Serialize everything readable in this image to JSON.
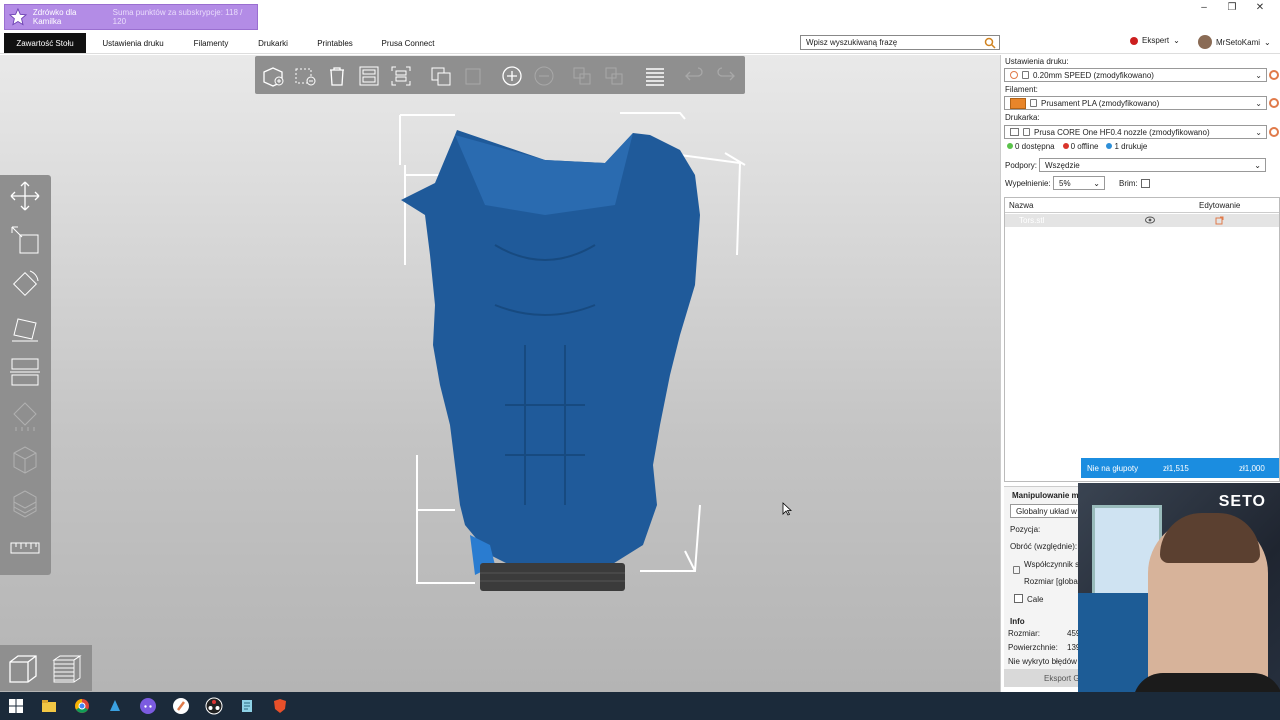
{
  "overlay": {
    "title": "Zdrówko dla Kamilka",
    "subtitle": "Suma punktów za subskrypcje: 118 / 120"
  },
  "window_controls": {
    "minimize": "–",
    "restore": "❐",
    "close": "✕"
  },
  "tabs": [
    {
      "label": "Zawartość Stołu",
      "active": true
    },
    {
      "label": "Ustawienia druku"
    },
    {
      "label": "Filamenty"
    },
    {
      "label": "Drukarki"
    },
    {
      "label": "Printables"
    },
    {
      "label": "Prusa Connect"
    }
  ],
  "search": {
    "placeholder": "Wpisz wyszukiwaną frazę"
  },
  "mode": {
    "label": "Ekspert"
  },
  "user": {
    "name": "MrSetoKami"
  },
  "right_panel": {
    "print_settings_label": "Ustawienia druku:",
    "print_settings_value": "0.20mm SPEED (zmodyfikowano)",
    "filament_label": "Filament:",
    "filament_value": "Prusament PLA (zmodyfikowano)",
    "printer_label": "Drukarka:",
    "printer_value": "Prusa CORE One HF0.4 nozzle (zmodyfikowano)",
    "status": {
      "available": "0 dostępna",
      "offline": "0 offline",
      "printing": "1 drukuje"
    },
    "supports_label": "Podpory:",
    "supports_value": "Wszędzie",
    "infill_label": "Wypełnienie:",
    "infill_value": "5%",
    "brim_label": "Brim:",
    "table": {
      "col_name": "Nazwa",
      "col_edit": "Edytowanie",
      "rows": [
        {
          "name": "Tors.stl"
        }
      ]
    },
    "banner": {
      "label": "Nie na głupoty",
      "value1": "zł1,515",
      "value2": "zł1,000"
    },
    "manipulation": {
      "title": "Manipulowanie m",
      "coord_system": "Globalny układ w",
      "position": "Pozycja:",
      "rotate": "Obróć (względnie):",
      "scale": "Współczynnik s",
      "size": "Rozmiar [global",
      "inches": "Cale",
      "info_title": "Info",
      "size_label": "Rozmiar:",
      "size_value": "459",
      "surface_label": "Powierzchnie:",
      "surface_value": "139",
      "errors": "Nie wykryto błędów",
      "export_button": "Eksport G"
    }
  },
  "webcam": {
    "logo": "SETO"
  },
  "colors": {
    "accent_blue": "#1b8de0",
    "model_blue": "#1f5a9a",
    "filament_orange": "#e8852a",
    "toolbar_gray": "#8f8f8f"
  }
}
